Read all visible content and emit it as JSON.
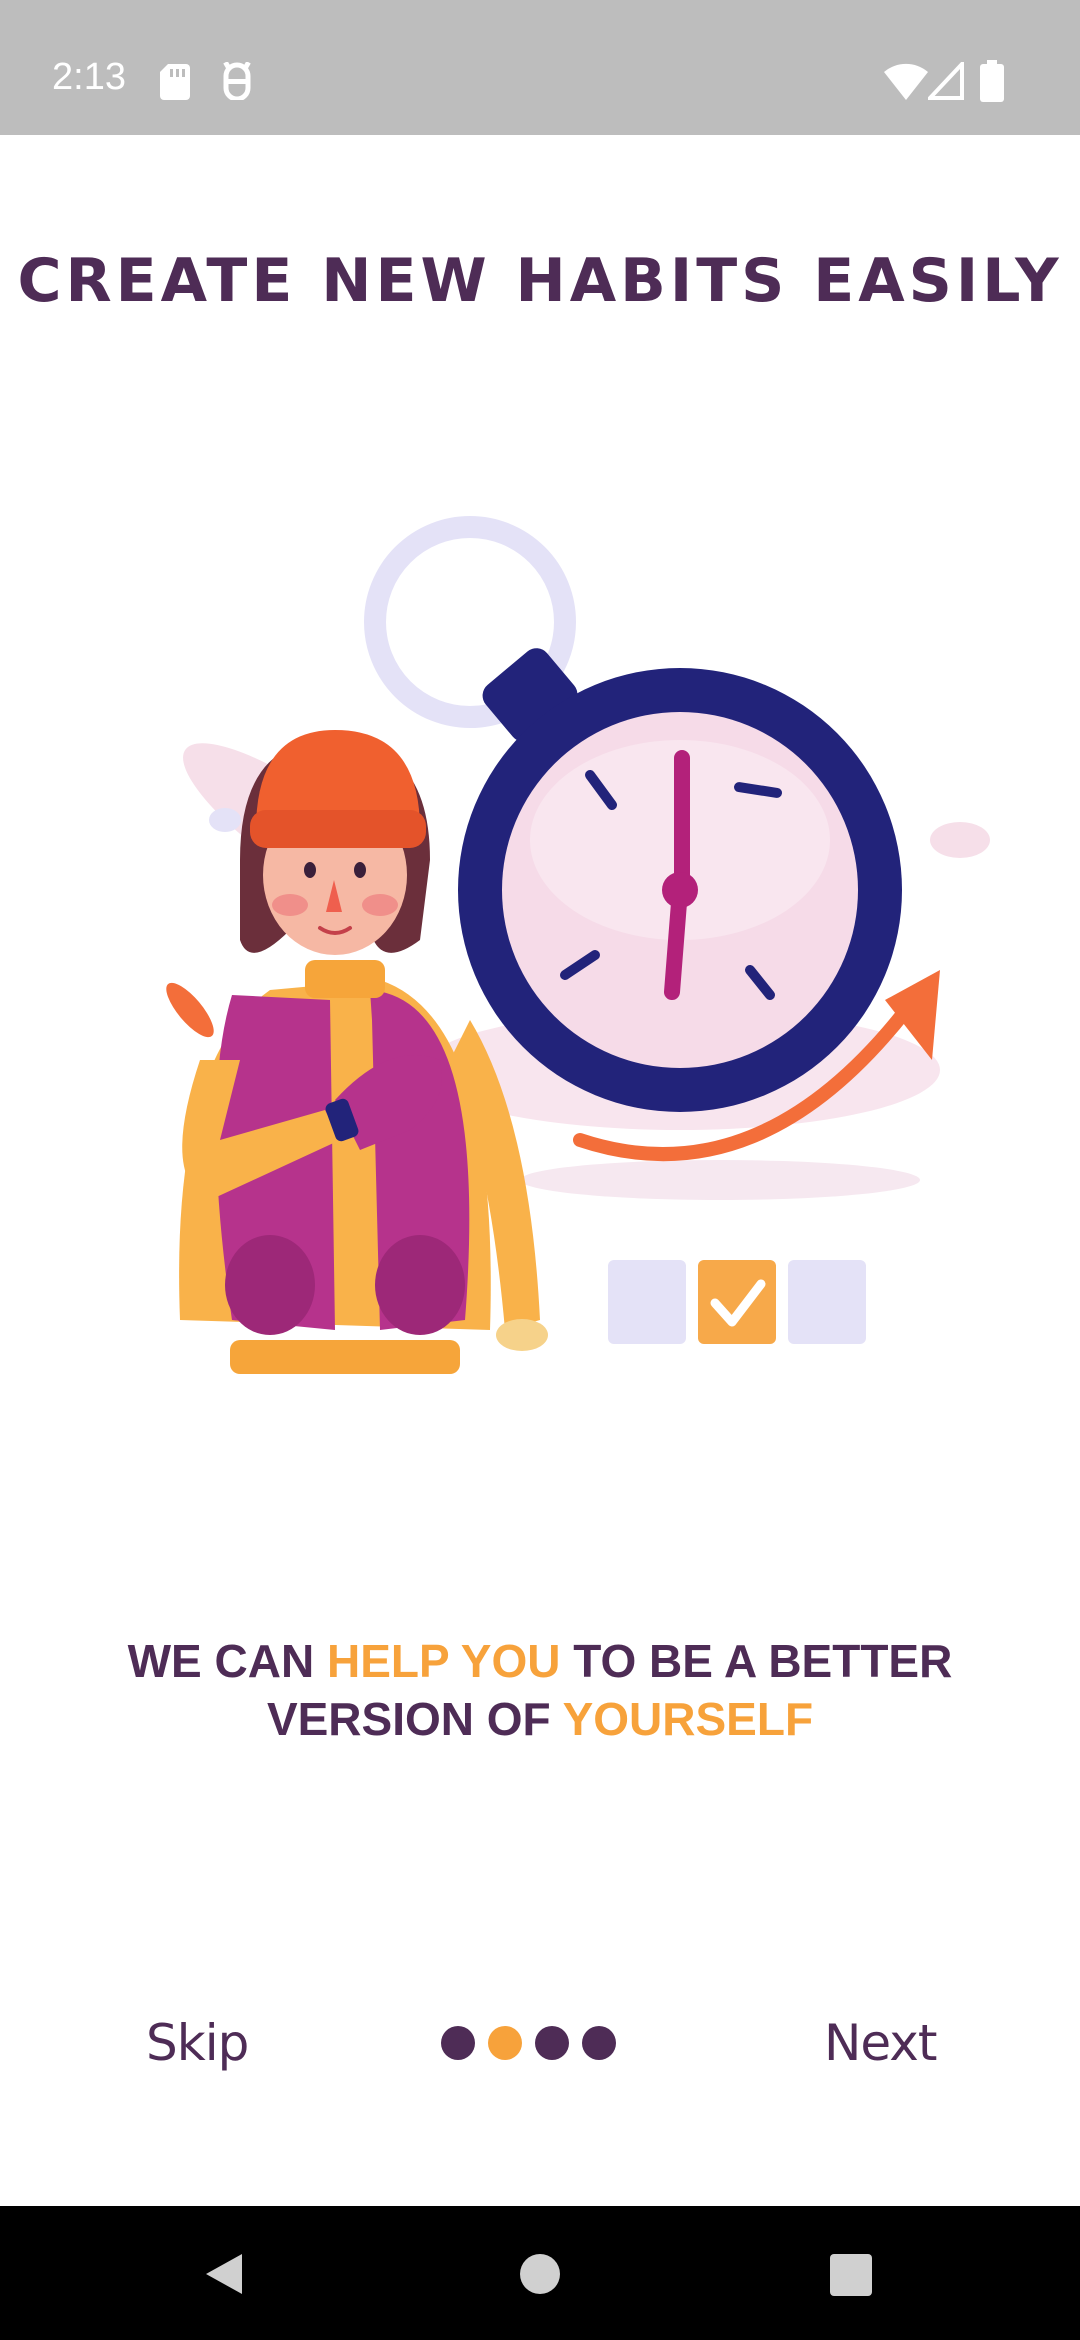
{
  "status_bar": {
    "time": "2:13",
    "icons": [
      "sd-card-icon",
      "debug-icon",
      "wifi-icon",
      "signal-icon",
      "battery-icon"
    ]
  },
  "onboarding": {
    "title": "CREATE NEW HABITS EASILY",
    "tagline_parts": {
      "p1": "WE CAN ",
      "p2": "HELP YOU",
      "p3": " TO BE A BETTER VERSION OF ",
      "p4": "YOURSELF"
    },
    "illustration": "habit-stopwatch-illustration",
    "page_indicator": {
      "total": 4,
      "active_index": 1
    },
    "skip_label": "Skip",
    "next_label": "Next"
  },
  "colors": {
    "primary": "#4e2c56",
    "accent": "#f7a23b",
    "status_bar": "#bdbdbd",
    "nav_bar": "#000000"
  },
  "nav_bar": {
    "icons": [
      "back-icon",
      "home-icon",
      "recents-icon"
    ]
  }
}
